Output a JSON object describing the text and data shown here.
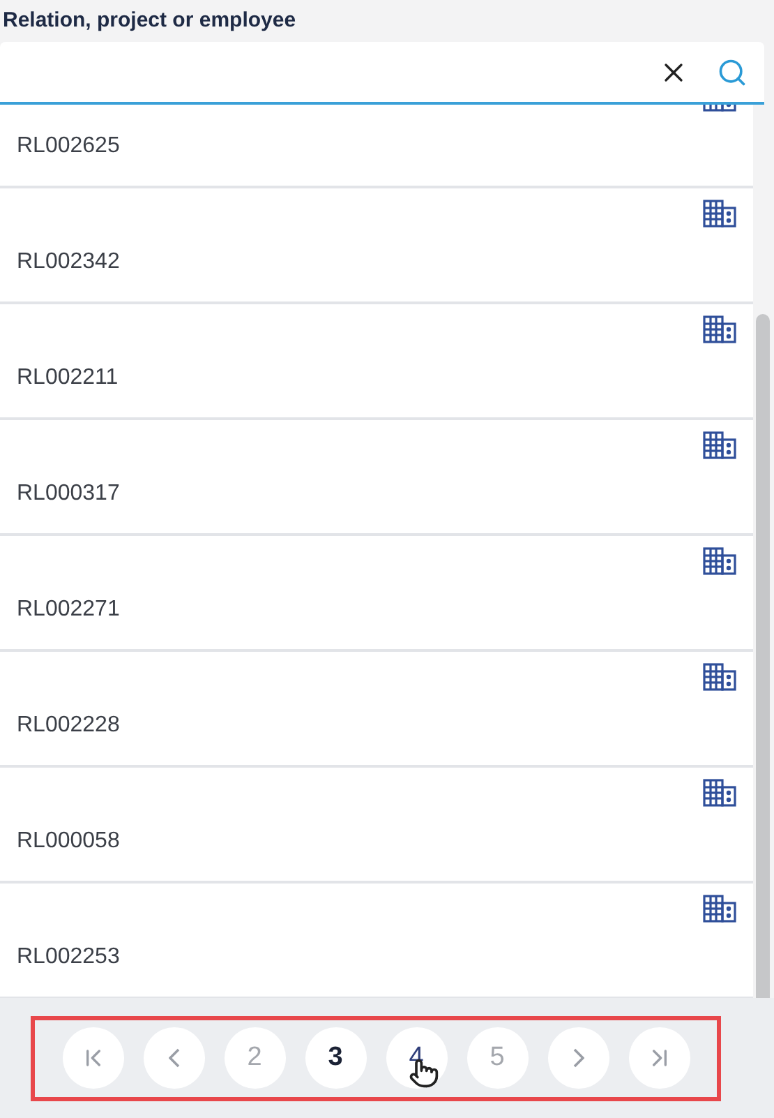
{
  "search": {
    "label": "Relation, project or employee"
  },
  "results": [
    {
      "code": "RL002625"
    },
    {
      "code": "RL002342"
    },
    {
      "code": "RL002211"
    },
    {
      "code": "RL000317"
    },
    {
      "code": "RL002271"
    },
    {
      "code": "RL002228"
    },
    {
      "code": "RL000058"
    },
    {
      "code": "RL002253"
    }
  ],
  "pagination": {
    "pages": [
      {
        "label": "2",
        "selected": false,
        "hovered": false
      },
      {
        "label": "3",
        "selected": true,
        "hovered": false
      },
      {
        "label": "4",
        "selected": false,
        "hovered": true
      },
      {
        "label": "5",
        "selected": false,
        "hovered": false
      }
    ]
  }
}
